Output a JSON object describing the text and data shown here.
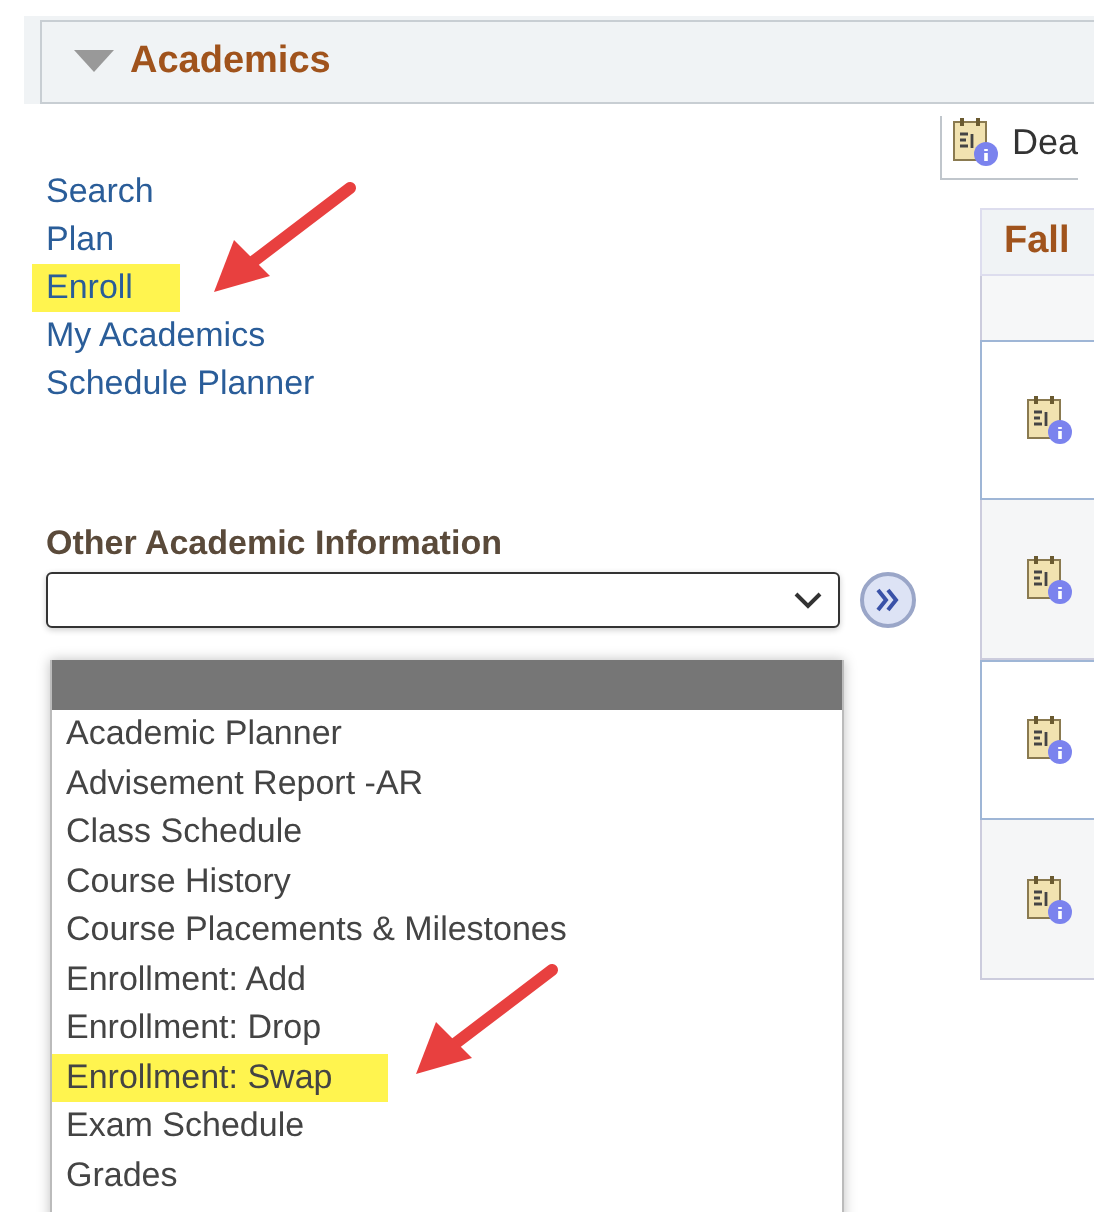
{
  "section": {
    "title": "Academics",
    "expanded": true
  },
  "links": [
    {
      "label": "Search",
      "highlighted": false
    },
    {
      "label": "Plan",
      "highlighted": false
    },
    {
      "label": "Enroll",
      "highlighted": true
    },
    {
      "label": "My Academics",
      "highlighted": false
    },
    {
      "label": "Schedule Planner",
      "highlighted": false
    }
  ],
  "other_info": {
    "label": "Other Academic Information",
    "dropdown_open": true,
    "blank_option_selected": true,
    "options": [
      {
        "label": "Academic Planner",
        "highlighted": false
      },
      {
        "label": "Advisement Report -AR",
        "highlighted": false
      },
      {
        "label": "Class Schedule",
        "highlighted": false
      },
      {
        "label": "Course History",
        "highlighted": false
      },
      {
        "label": "Course Placements & Milestones",
        "highlighted": false
      },
      {
        "label": "Enrollment: Add",
        "highlighted": false
      },
      {
        "label": "Enrollment: Drop",
        "highlighted": false
      },
      {
        "label": "Enrollment: Swap",
        "highlighted": true
      },
      {
        "label": "Exam Schedule",
        "highlighted": false
      },
      {
        "label": "Grades",
        "highlighted": false
      }
    ]
  },
  "deadlines_button": {
    "label": "Dea"
  },
  "term_table": {
    "title": "Fall"
  }
}
